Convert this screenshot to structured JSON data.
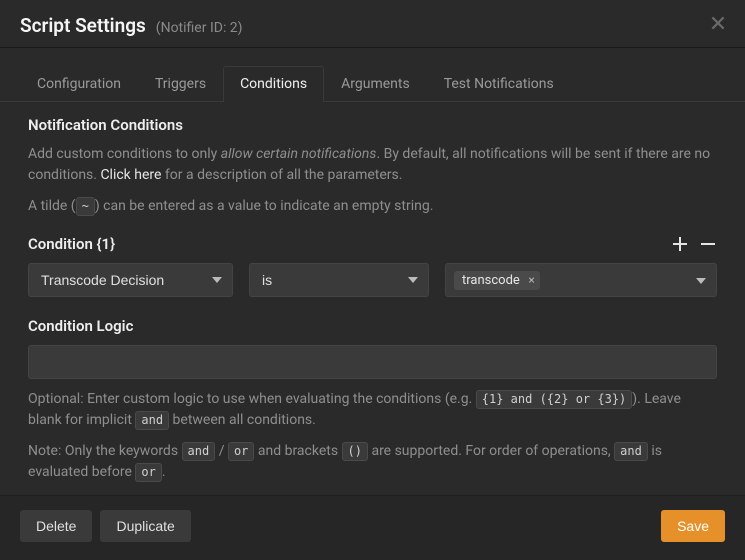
{
  "header": {
    "title": "Script Settings",
    "subtitle": "(Notifier ID: 2)"
  },
  "tabs": [
    {
      "label": "Configuration",
      "active": false
    },
    {
      "label": "Triggers",
      "active": false
    },
    {
      "label": "Conditions",
      "active": true
    },
    {
      "label": "Arguments",
      "active": false
    },
    {
      "label": "Test Notifications",
      "active": false
    }
  ],
  "section": {
    "title": "Notification Conditions",
    "desc_prefix": "Add custom conditions to only ",
    "desc_italic": "allow certain notifications",
    "desc_mid": ". By default, all notifications will be sent if there are no conditions. ",
    "desc_link": "Click here",
    "desc_suffix": " for a description of all the parameters.",
    "tilde_prefix": "A tilde (",
    "tilde_code": "~",
    "tilde_suffix": ") can be entered as a value to indicate an empty string."
  },
  "condition": {
    "label": "Condition {1}",
    "parameter": "Transcode Decision",
    "operator": "is",
    "value_tag": "transcode"
  },
  "logic": {
    "label": "Condition Logic",
    "value": "",
    "help_prefix": "Optional: Enter custom logic to use when evaluating the conditions (e.g. ",
    "help_code_example": "{1} and ({2} or {3})",
    "help_mid": "). Leave blank for implicit ",
    "help_code_and": "and",
    "help_suffix": " between all conditions.",
    "note_prefix": "Note: Only the keywords ",
    "note_and": "and",
    "note_slash": " / ",
    "note_or": "or",
    "note_mid": " and brackets ",
    "note_paren": "()",
    "note_mid2": " are supported. For order of operations, ",
    "note_and2": "and",
    "note_mid3": " is evaluated before ",
    "note_or2": "or",
    "note_end": "."
  },
  "footer": {
    "delete": "Delete",
    "duplicate": "Duplicate",
    "save": "Save"
  }
}
